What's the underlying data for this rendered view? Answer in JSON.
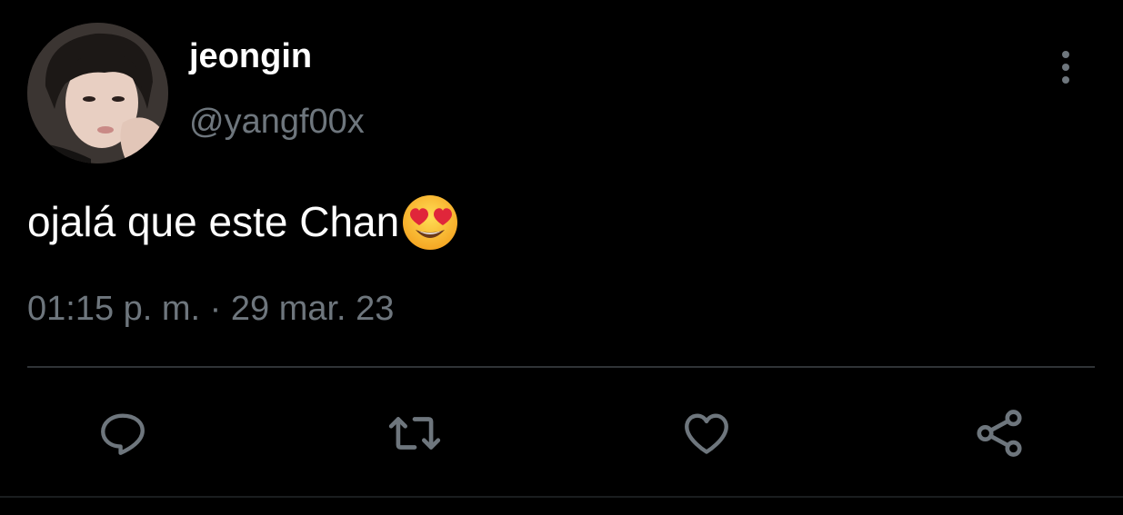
{
  "user": {
    "display_name": "jeongin",
    "handle": "@yangf00x"
  },
  "tweet": {
    "text": "ojalá que este Chan",
    "emoji": "smiling-face-with-heart-eyes",
    "timestamp": "01:15 p. m. · 29 mar. 23"
  },
  "actions": [
    {
      "name": "reply",
      "icon": "reply-icon"
    },
    {
      "name": "retweet",
      "icon": "retweet-icon"
    },
    {
      "name": "like",
      "icon": "heart-icon"
    },
    {
      "name": "share",
      "icon": "share-icon"
    }
  ],
  "colors": {
    "background": "#000000",
    "primary_text": "#ffffff",
    "secondary_text": "#6e767d",
    "divider": "#2f3336"
  }
}
